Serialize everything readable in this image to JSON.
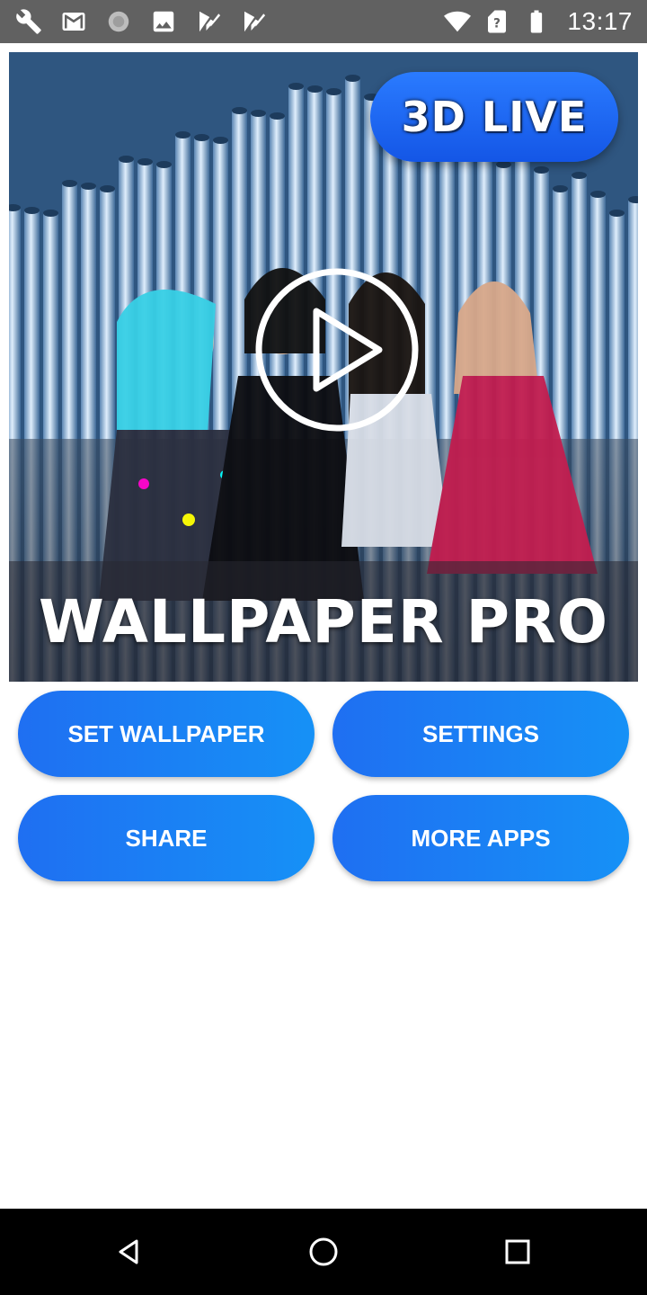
{
  "status_bar": {
    "time": "13:17",
    "left_icons": [
      "wrench-icon",
      "gmail-icon",
      "loading-icon",
      "image-icon",
      "play-store-check-icon",
      "play-store-check-icon"
    ],
    "right_icons": [
      "wifi-icon",
      "no-sim-icon",
      "battery-icon"
    ]
  },
  "banner": {
    "badge_text": "3D LIVE",
    "title_text": "WALLPAPER PRO",
    "play_icon": "play-circle-icon"
  },
  "buttons": {
    "set_wallpaper": "SET WALLPAPER",
    "settings": "SETTINGS",
    "share": "SHARE",
    "more_apps": "MORE APPS"
  },
  "colors": {
    "button_start": "#1f6ff2",
    "button_end": "#1691f6",
    "status_bar": "#616161",
    "nav_bar": "#000000"
  },
  "nav_bar": {
    "icons": [
      "back-icon",
      "home-icon",
      "recents-icon"
    ]
  }
}
